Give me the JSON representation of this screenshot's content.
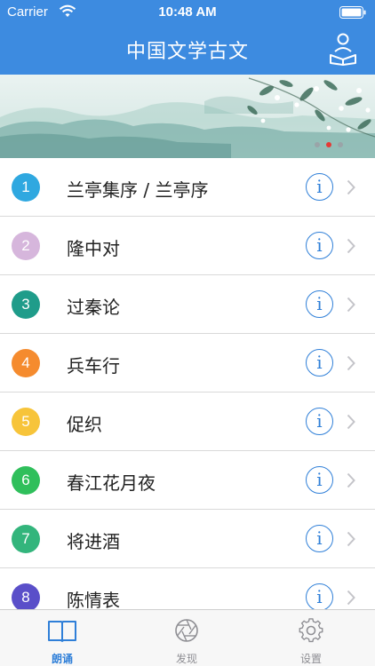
{
  "status_bar": {
    "carrier": "Carrier",
    "time": "10:48 AM"
  },
  "nav": {
    "title": "中国文学古文",
    "profile_icon": "reading-person-icon"
  },
  "banner": {
    "dots": 3,
    "active_dot": 2
  },
  "list": [
    {
      "num": "1",
      "title": "兰亭集序 / 兰亭序",
      "color": "#2fa8e0"
    },
    {
      "num": "2",
      "title": "隆中对",
      "color": "#d6b6dc"
    },
    {
      "num": "3",
      "title": "过秦论",
      "color": "#1f9c8a"
    },
    {
      "num": "4",
      "title": "兵车行",
      "color": "#f58b2e"
    },
    {
      "num": "5",
      "title": "促织",
      "color": "#f7c43a"
    },
    {
      "num": "6",
      "title": "春江花月夜",
      "color": "#2fbf5b"
    },
    {
      "num": "7",
      "title": "将进酒",
      "color": "#33b57c"
    },
    {
      "num": "8",
      "title": "陈情表",
      "color": "#5a4fc9"
    }
  ],
  "info_label": "i",
  "tabs": [
    {
      "label": "朗诵",
      "icon": "book-icon",
      "active": true
    },
    {
      "label": "发现",
      "icon": "aperture-icon",
      "active": false
    },
    {
      "label": "设置",
      "icon": "gear-icon",
      "active": false
    }
  ],
  "colors": {
    "header": "#3d8be0",
    "accent": "#2f7fd8"
  }
}
